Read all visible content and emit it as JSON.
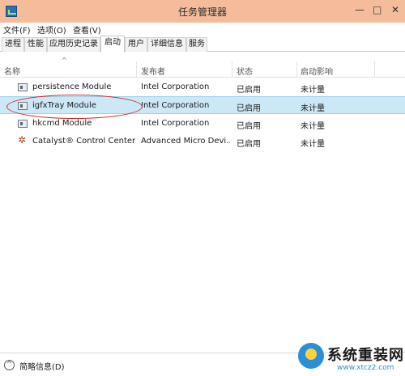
{
  "window": {
    "title": "任务管理器",
    "controls": {
      "minimize": "—",
      "maximize": "□",
      "close": "✕"
    }
  },
  "menu": [
    "文件(F)",
    "选项(O)",
    "查看(V)"
  ],
  "tabs": [
    "进程",
    "性能",
    "应用历史记录",
    "启动",
    "用户",
    "详细信息",
    "服务"
  ],
  "active_tab": "启动",
  "columns": [
    "名称",
    "发布者",
    "状态",
    "启动影响"
  ],
  "rows": [
    {
      "name": "persistence Module",
      "publisher": "Intel Corporation",
      "status": "已启用",
      "impact": "未计量",
      "icon": "module-icon"
    },
    {
      "name": "igfxTray Module",
      "publisher": "Intel Corporation",
      "status": "已启用",
      "impact": "未计量",
      "icon": "module-icon",
      "selected": true
    },
    {
      "name": "hkcmd Module",
      "publisher": "Intel Corporation",
      "status": "已启用",
      "impact": "未计量",
      "icon": "module-icon"
    },
    {
      "name": "Catalyst® Control Center ...",
      "publisher": "Advanced Micro Devi...",
      "status": "已启用",
      "impact": "未计量",
      "icon": "catalyst-icon"
    }
  ],
  "footer": {
    "label": "简略信息(D)",
    "toggle_glyph": "^"
  },
  "watermark": {
    "text": "系统重装网",
    "url": "www.xtcz2.com"
  },
  "colors": {
    "titlebar": "#f4bc9b",
    "selected_row": "#cce8f6",
    "annotation": "#c62828"
  }
}
